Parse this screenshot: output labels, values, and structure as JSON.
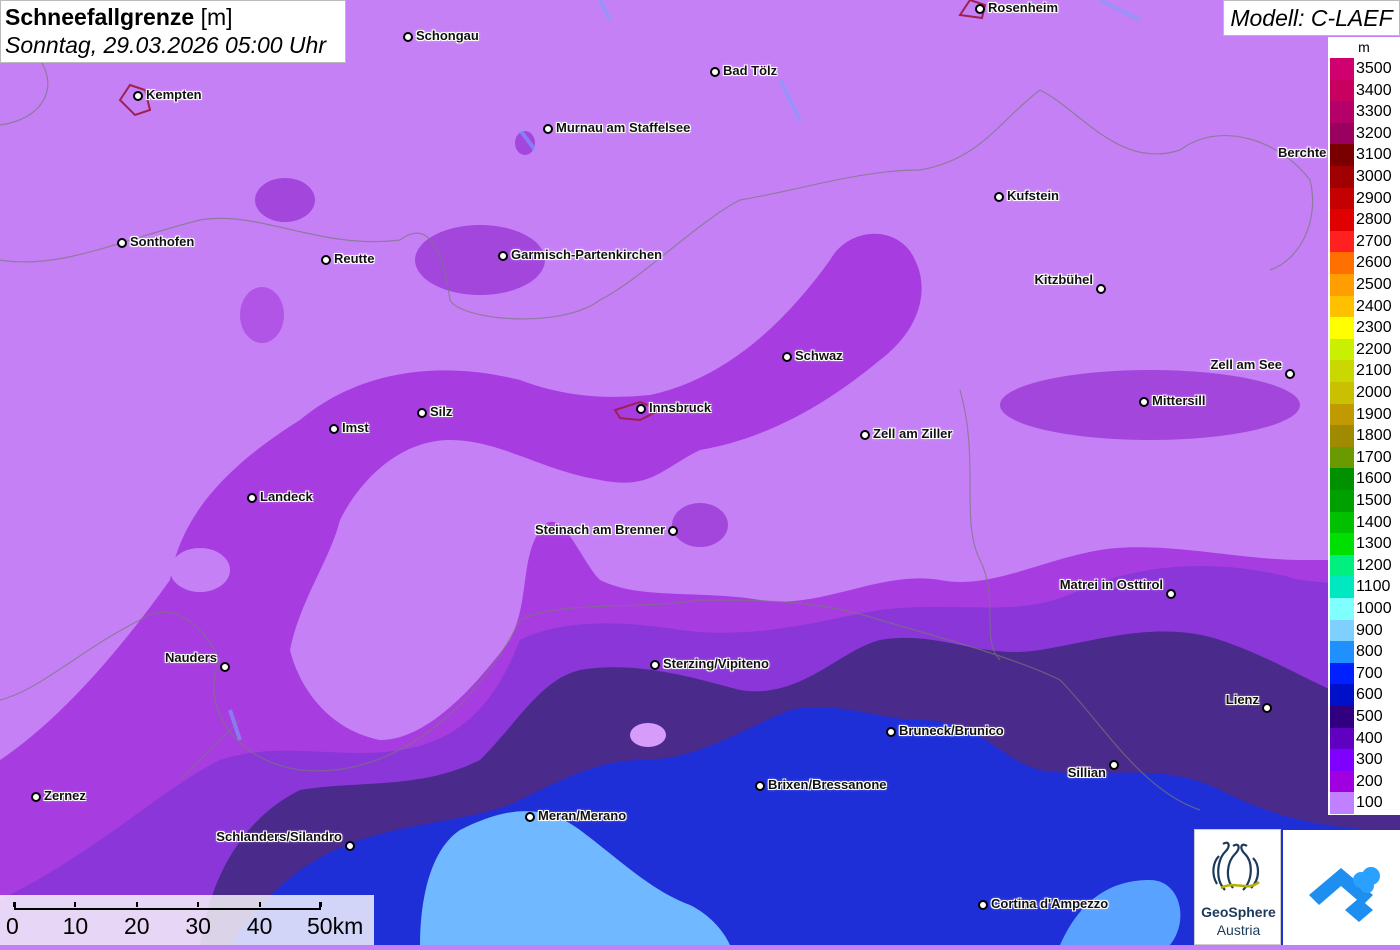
{
  "header": {
    "title_bold": "Schneefallgrenze",
    "title_unit": "[m]",
    "subtitle": "Sonntag, 29.03.2026 05:00 Uhr",
    "model": "Modell: C-LAEF"
  },
  "legend": {
    "unit": "m",
    "items": [
      {
        "label": "3500",
        "color": "#d0006f"
      },
      {
        "label": "3400",
        "color": "#c80060"
      },
      {
        "label": "3300",
        "color": "#b40068"
      },
      {
        "label": "3200",
        "color": "#9a0060"
      },
      {
        "label": "3100",
        "color": "#7a0000"
      },
      {
        "label": "3000",
        "color": "#a00000"
      },
      {
        "label": "2900",
        "color": "#c40000"
      },
      {
        "label": "2800",
        "color": "#e00000"
      },
      {
        "label": "2700",
        "color": "#ff2020"
      },
      {
        "label": "2600",
        "color": "#ff7000"
      },
      {
        "label": "2500",
        "color": "#ff9e00"
      },
      {
        "label": "2400",
        "color": "#ffc000"
      },
      {
        "label": "2300",
        "color": "#ffff00"
      },
      {
        "label": "2200",
        "color": "#c8f000"
      },
      {
        "label": "2100",
        "color": "#c8d800"
      },
      {
        "label": "2000",
        "color": "#c8c000"
      },
      {
        "label": "1900",
        "color": "#c09a00"
      },
      {
        "label": "1800",
        "color": "#a08a00"
      },
      {
        "label": "1700",
        "color": "#6a9a00"
      },
      {
        "label": "1600",
        "color": "#009000"
      },
      {
        "label": "1500",
        "color": "#00a000"
      },
      {
        "label": "1400",
        "color": "#00c000"
      },
      {
        "label": "1300",
        "color": "#00e000"
      },
      {
        "label": "1200",
        "color": "#00f080"
      },
      {
        "label": "1100",
        "color": "#00e8c0"
      },
      {
        "label": "1000",
        "color": "#80ffff"
      },
      {
        "label": "900",
        "color": "#80d0ff"
      },
      {
        "label": "800",
        "color": "#2090ff"
      },
      {
        "label": "700",
        "color": "#0020ff"
      },
      {
        "label": "600",
        "color": "#0010c8"
      },
      {
        "label": "500",
        "color": "#300080"
      },
      {
        "label": "400",
        "color": "#6000c0"
      },
      {
        "label": "300",
        "color": "#8000ff"
      },
      {
        "label": "200",
        "color": "#a000e0"
      },
      {
        "label": "100",
        "color": "#c080ff"
      }
    ]
  },
  "cities": [
    {
      "name": "Schongau"
    },
    {
      "name": "Rosenheim"
    },
    {
      "name": "Bad Tölz"
    },
    {
      "name": "Kempten"
    },
    {
      "name": "Murnau am Staffelsee"
    },
    {
      "name": "Berchte"
    },
    {
      "name": "Kufstein"
    },
    {
      "name": "Sonthofen"
    },
    {
      "name": "Reutte"
    },
    {
      "name": "Garmisch-Partenkirchen"
    },
    {
      "name": "Kitzbühel"
    },
    {
      "name": "Schwaz"
    },
    {
      "name": "Zell am See"
    },
    {
      "name": "Mittersill"
    },
    {
      "name": "Innsbruck"
    },
    {
      "name": "Silz"
    },
    {
      "name": "Imst"
    },
    {
      "name": "Zell am Ziller"
    },
    {
      "name": "Landeck"
    },
    {
      "name": "Steinach am Brenner"
    },
    {
      "name": "Matrei in Osttirol"
    },
    {
      "name": "Nauders"
    },
    {
      "name": "Sterzing/Vipiteno"
    },
    {
      "name": "Lienz"
    },
    {
      "name": "Bruneck/Brunico"
    },
    {
      "name": "Sillian"
    },
    {
      "name": "Brixen/Bressanone"
    },
    {
      "name": "Zernez"
    },
    {
      "name": "Meran/Merano"
    },
    {
      "name": "Schlanders/Silandro"
    },
    {
      "name": "Cortina d'Ampezzo"
    }
  ],
  "scalebar": {
    "labels": [
      "0",
      "10",
      "20",
      "30",
      "40",
      "50km"
    ]
  },
  "logos": {
    "geosphere_line1": "GeoSphere",
    "geosphere_line2": "Austria"
  }
}
